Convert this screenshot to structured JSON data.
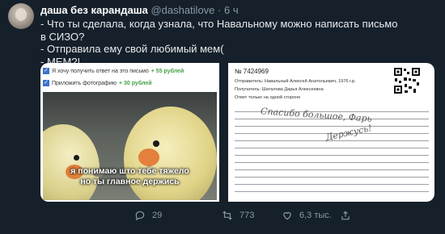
{
  "tweet": {
    "author_name": "даша без карандаша",
    "handle": "@dashatilove",
    "separator": "·",
    "time": "6 ч",
    "lines": [
      "- Что ты сделала, когда узнала, что Навальному можно написать письмо",
      "в СИЗО?",
      "- Отправила ему свой любимый мем(",
      "- МЕМ?!"
    ]
  },
  "media": {
    "options": [
      {
        "label": "Я хочу получить ответ на это письмо",
        "price": "+ 55 рублей"
      },
      {
        "label": "Приложить фотографию",
        "price": "+ 30 рублей"
      }
    ],
    "meme_caption": [
      "я понимаю што тебе тяжело",
      "но ты главное держись"
    ],
    "letter": {
      "number": "№ 7424969",
      "sender": "Отправитель: Навальный Алексей Анатольевич, 1976 г.р.",
      "recipient": "Получатель: Шаталова Дарья Алексеевна",
      "note": "Ответ только на одной стороне",
      "handwriting": [
        "Спасибо большое, Фарь",
        "Держусь!"
      ]
    }
  },
  "actions": {
    "reply_count": "29",
    "retweet_count": "773",
    "like_count": "6,3 тыс."
  },
  "colors": {
    "background": "#15202b",
    "muted": "#8899a6",
    "checkbox": "#3b73c8",
    "price": "#43a047"
  }
}
